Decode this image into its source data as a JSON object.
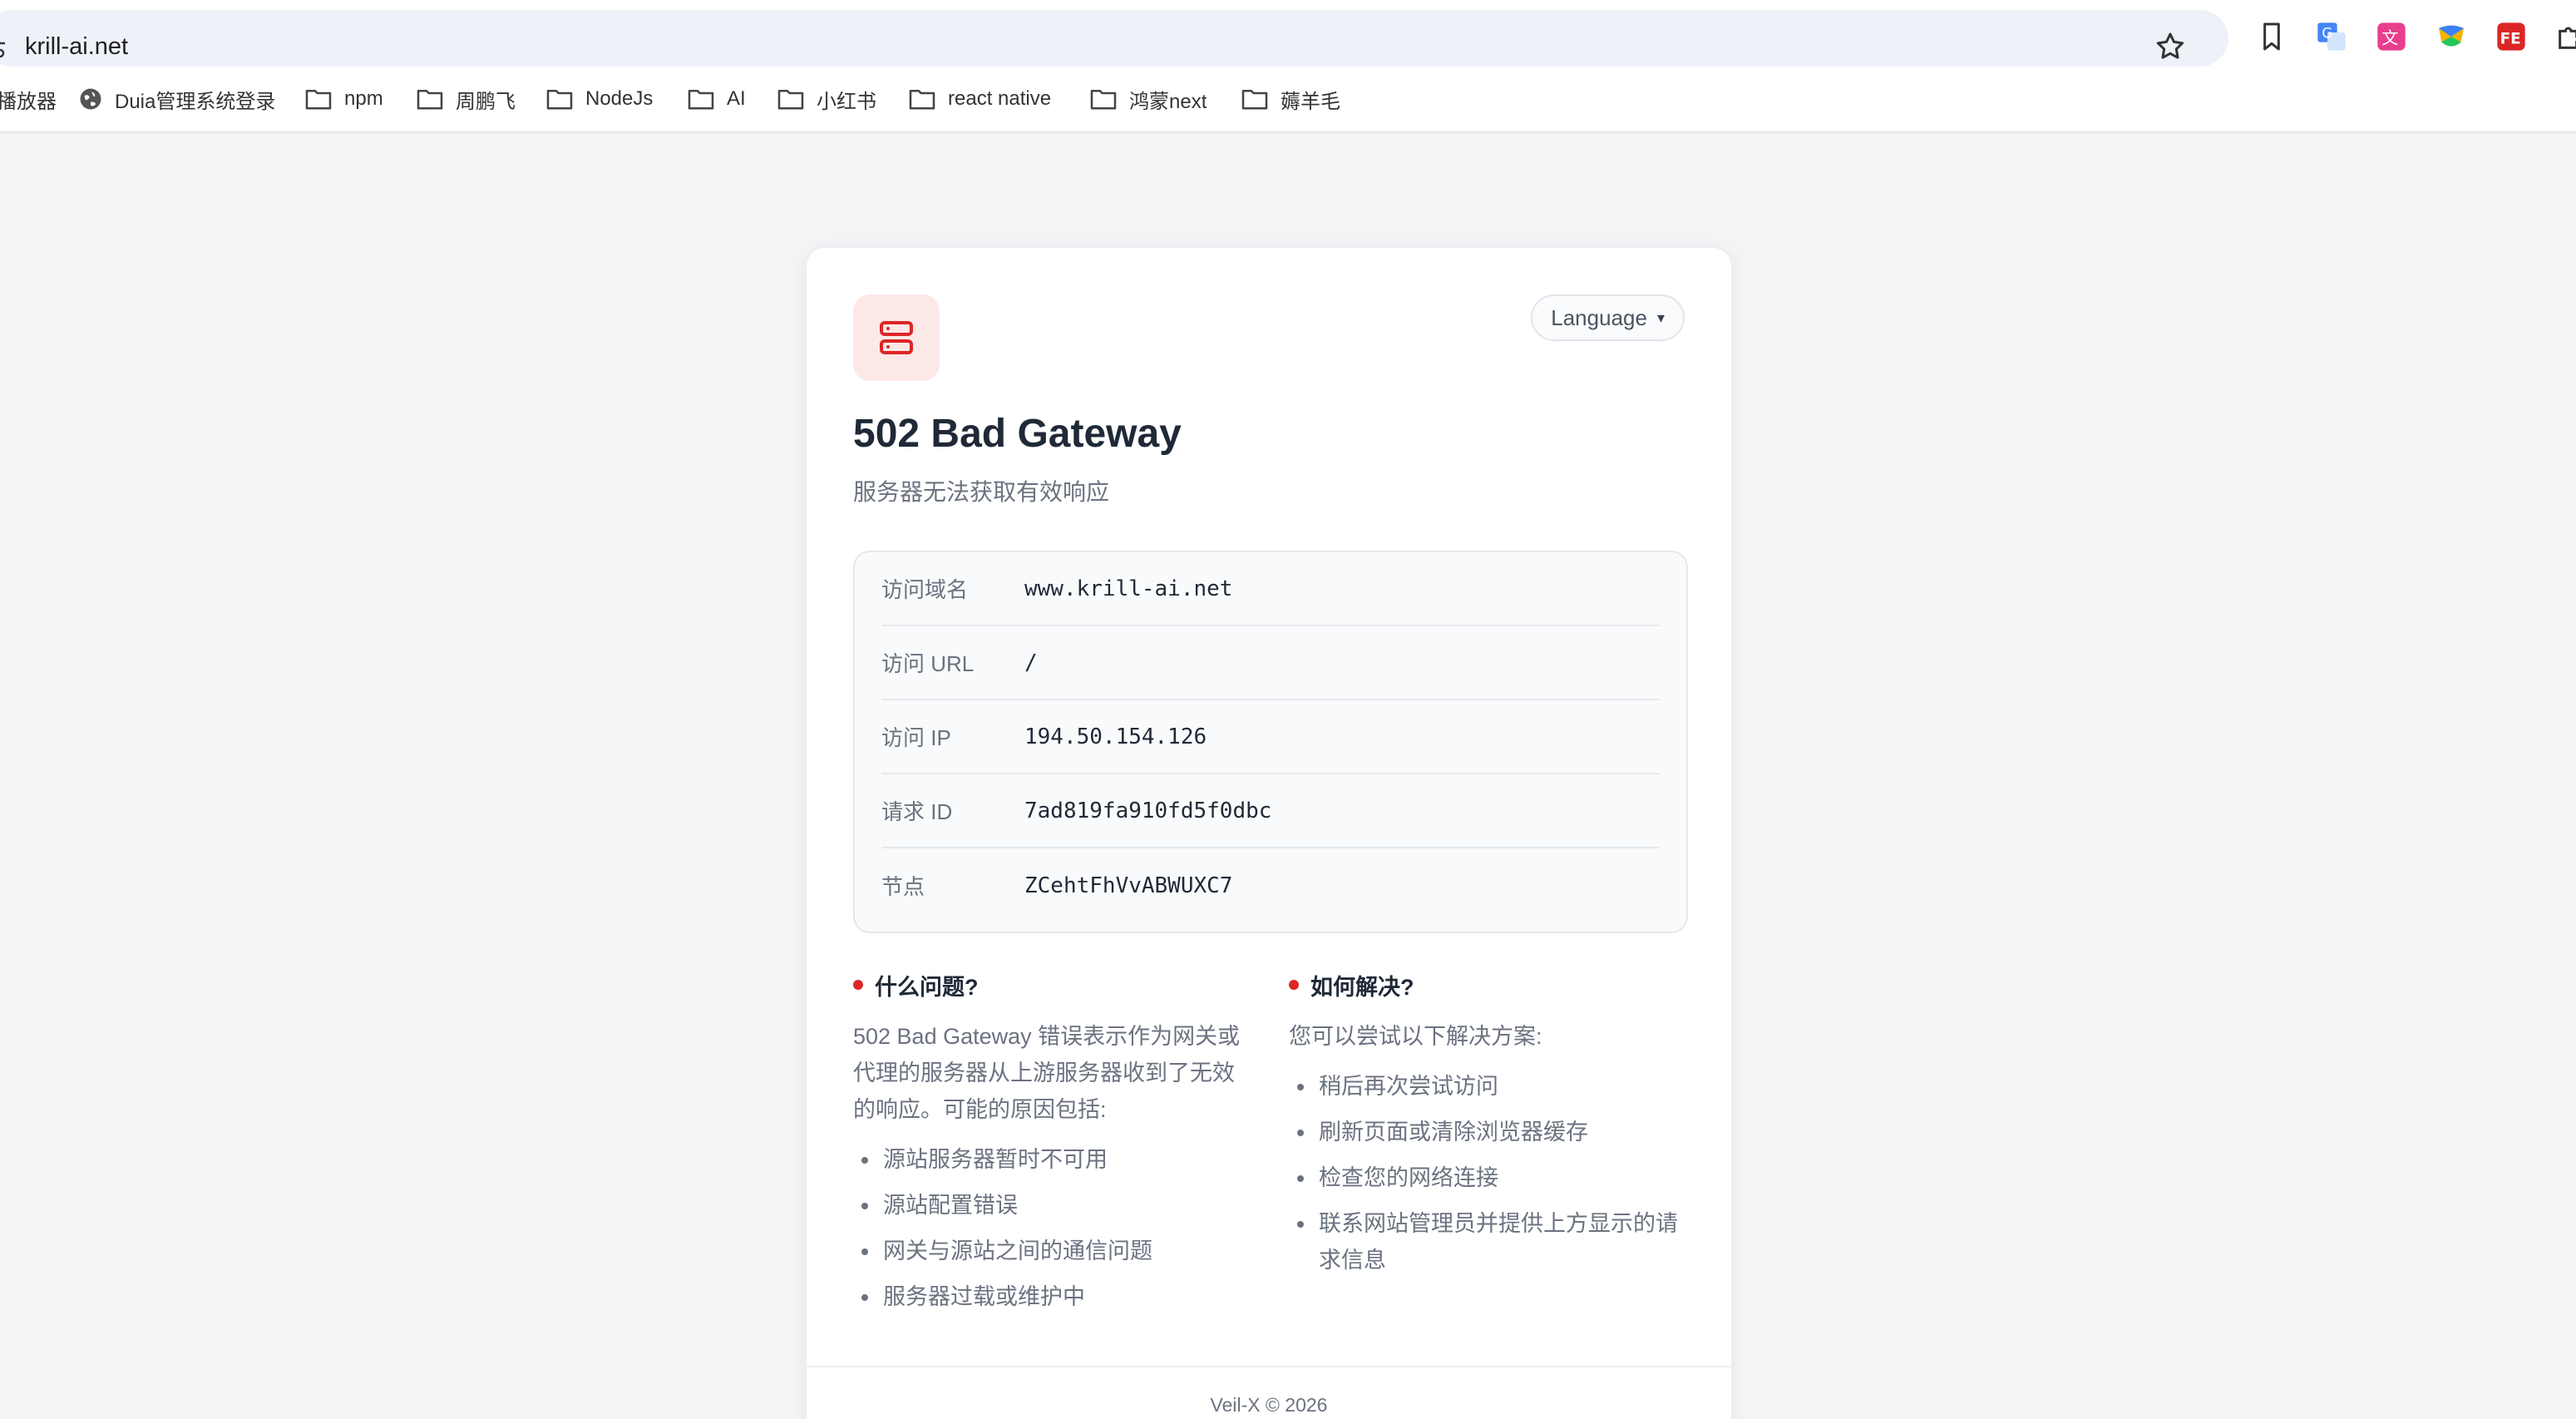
{
  "browser": {
    "url": "krill-ai.net",
    "bookmarks": [
      {
        "label": "播放器",
        "icon": "none"
      },
      {
        "label": "Duia管理系统登录",
        "icon": "globe-icon"
      },
      {
        "label": "npm",
        "icon": "folder-icon"
      },
      {
        "label": "周鹏飞",
        "icon": "folder-icon"
      },
      {
        "label": "NodeJs",
        "icon": "folder-icon"
      },
      {
        "label": "AI",
        "icon": "folder-icon"
      },
      {
        "label": "小红书",
        "icon": "folder-icon"
      },
      {
        "label": "react native",
        "icon": "folder-icon"
      },
      {
        "label": "鸿蒙next",
        "icon": "folder-icon"
      },
      {
        "label": "薅羊毛",
        "icon": "folder-icon"
      }
    ]
  },
  "card": {
    "language_label": "Language",
    "language_caret": "▾",
    "title": "502 Bad Gateway",
    "subtitle": "服务器无法获取有效响应",
    "info": [
      {
        "label": "访问域名",
        "value": "www.krill-ai.net"
      },
      {
        "label": "访问 URL",
        "value": "/"
      },
      {
        "label": "访问 IP",
        "value": "194.50.154.126"
      },
      {
        "label": "请求 ID",
        "value": "7ad819fa910fd5f0dbc"
      },
      {
        "label": "节点",
        "value": "ZCehtFhVvABWUXC7"
      }
    ],
    "problem": {
      "heading": "什么问题?",
      "description": "502 Bad Gateway 错误表示作为网关或代理的服务器从上游服务器收到了无效的响应。可能的原因包括:",
      "items": [
        "源站服务器暂时不可用",
        "源站配置错误",
        "网关与源站之间的通信问题",
        "服务器过载或维护中"
      ]
    },
    "solution": {
      "heading": "如何解决?",
      "description": "您可以尝试以下解决方案:",
      "items": [
        "稍后再次尝试访问",
        "刷新页面或清除浏览器缓存",
        "检查您的网络连接",
        "联系网站管理员并提供上方显示的请求信息"
      ]
    },
    "footer": "Veil-X © 2026"
  },
  "colors": {
    "accent_red": "#dc2626",
    "icon_bg": "#fde8e8",
    "page_bg": "#f3f4f6"
  }
}
